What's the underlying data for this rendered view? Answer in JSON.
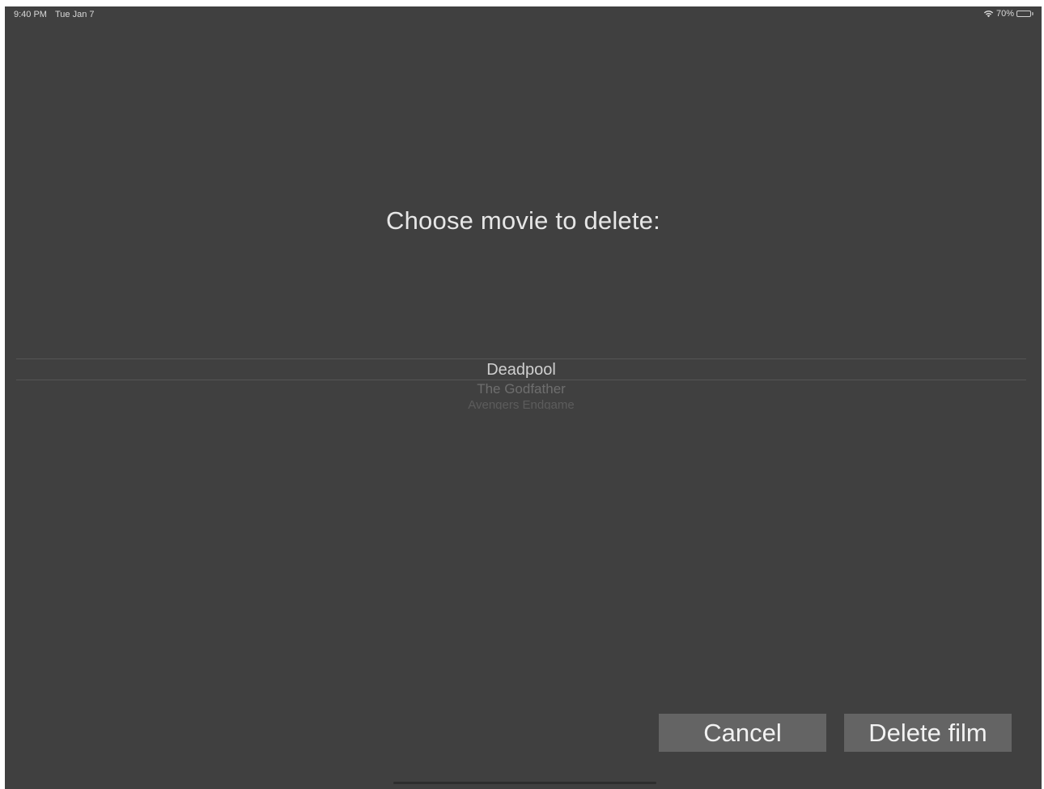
{
  "status_bar": {
    "time": "9:40 PM",
    "date": "Tue Jan 7",
    "battery_text": "70%",
    "battery_level": 0.7,
    "icons": [
      "wifi-icon",
      "battery-icon"
    ]
  },
  "prompt": {
    "text": "Choose movie to delete:"
  },
  "picker": {
    "items": [
      "Deadpool",
      "The Godfather",
      "Avengers Endgame"
    ],
    "selected_index": 0
  },
  "buttons": {
    "cancel_label": "Cancel",
    "delete_label": "Delete film"
  },
  "colors": {
    "background": "#404040",
    "button": "#646464",
    "text": "#e6e6e6"
  }
}
